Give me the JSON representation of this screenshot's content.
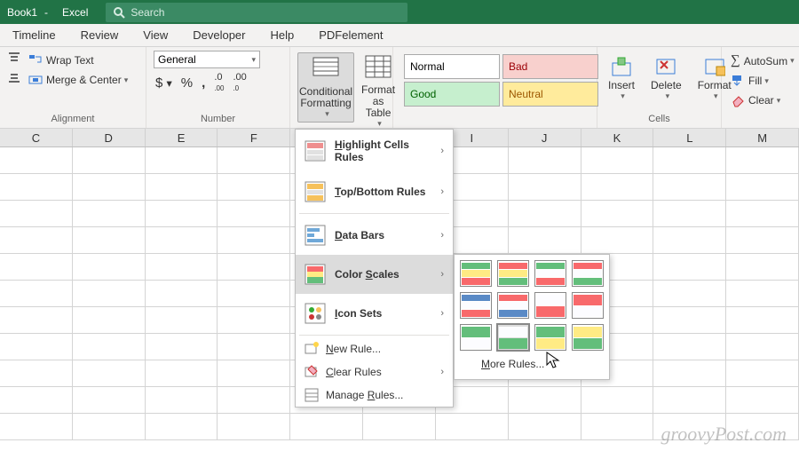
{
  "title": {
    "book": "Book1",
    "sep": "-",
    "app": "Excel",
    "search": "Search"
  },
  "tabs": [
    "Timeline",
    "Review",
    "View",
    "Developer",
    "Help",
    "PDFelement"
  ],
  "ribbon": {
    "alignment": {
      "wrap": "Wrap Text",
      "merge": "Merge & Center",
      "label": "Alignment"
    },
    "number": {
      "combo": "General",
      "label": "Number"
    },
    "condfmt": "Conditional\nFormatting",
    "fmttable": "Format as\nTable",
    "styles": {
      "normal": "Normal",
      "bad": "Bad",
      "good": "Good",
      "neutral": "Neutral"
    },
    "cells": {
      "insert": "Insert",
      "delete": "Delete",
      "format": "Format",
      "label": "Cells"
    },
    "edit": {
      "autosum": "AutoSum",
      "fill": "Fill",
      "clear": "Clear"
    }
  },
  "cols": [
    "C",
    "D",
    "E",
    "F",
    "",
    "I",
    "J",
    "K",
    "L",
    "M"
  ],
  "cf_menu": {
    "highlight": "Highlight Cells Rules",
    "topbottom": "Top/Bottom Rules",
    "databars": "Data Bars",
    "colorscales": "Color Scales",
    "iconsets": "Icon Sets",
    "newrule": "New Rule...",
    "clear": "Clear Rules",
    "manage": "Manage Rules..."
  },
  "flyout": {
    "more": "More Rules...",
    "scales": [
      [
        "#63be7b",
        "#ffeb84",
        "#f8696b"
      ],
      [
        "#f8696b",
        "#ffeb84",
        "#63be7b"
      ],
      [
        "#63be7b",
        "#fcfcff",
        "#f8696b"
      ],
      [
        "#f8696b",
        "#fcfcff",
        "#63be7b"
      ],
      [
        "#5a8ac6",
        "#fcfcff",
        "#f8696b"
      ],
      [
        "#f8696b",
        "#fcfcff",
        "#5a8ac6"
      ],
      [
        "#fcfcff",
        "#f8696b"
      ],
      [
        "#f8696b",
        "#fcfcff"
      ],
      [
        "#63be7b",
        "#fcfcff"
      ],
      [
        "#fcfcff",
        "#63be7b"
      ],
      [
        "#63be7b",
        "#ffeb84"
      ],
      [
        "#ffeb84",
        "#63be7b"
      ]
    ],
    "hover_index": 9
  },
  "watermark": "groovyPost.com"
}
